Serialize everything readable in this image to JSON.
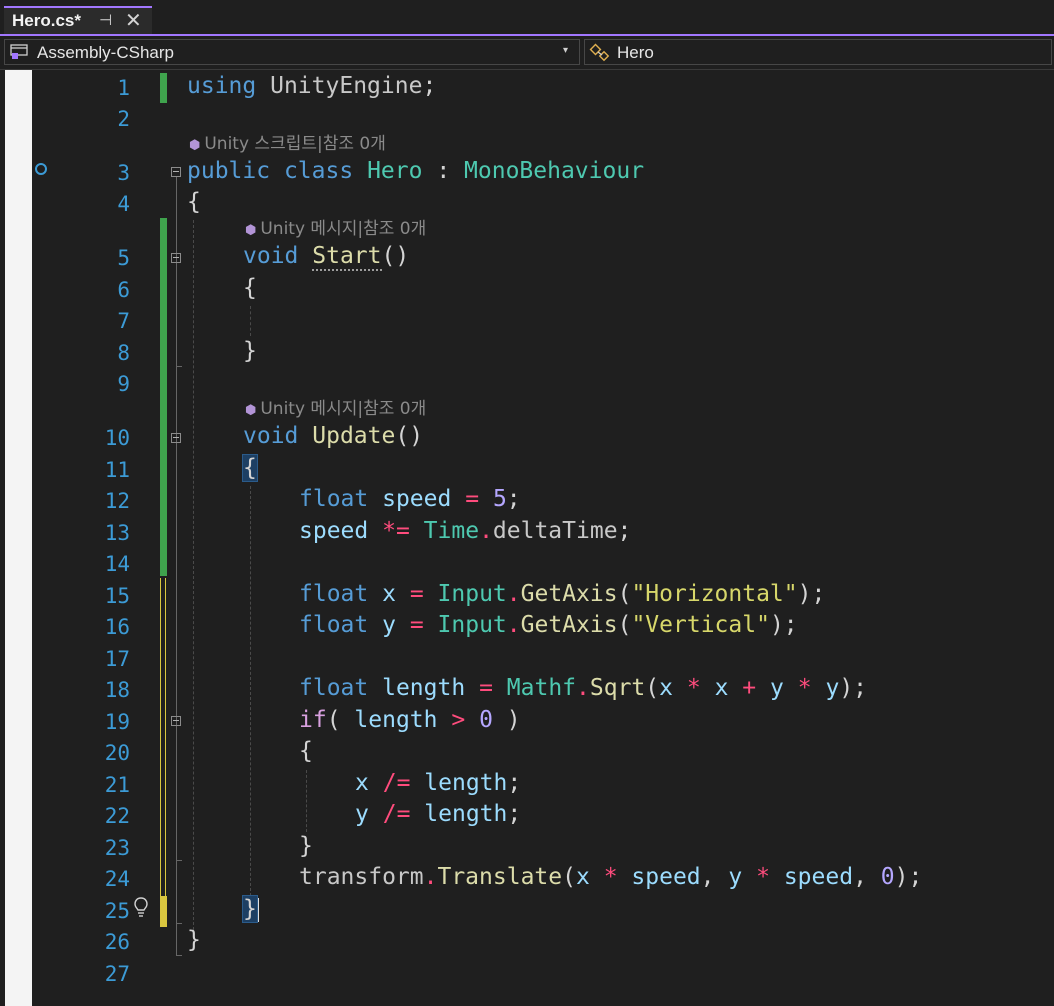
{
  "tab": {
    "title": "Hero.cs*",
    "pin": "⊣",
    "close": "✕"
  },
  "nav": {
    "project": "Assembly-CSharp",
    "dropdown": "▾",
    "class": "Hero"
  },
  "codelens": {
    "class_lens": "Unity 스크립트|참조 0개",
    "start_lens": "Unity 메시지|참조 0개",
    "update_lens": "Unity 메시지|참조 0개"
  },
  "code": {
    "l1": [
      "using",
      "UnityEngine",
      ";"
    ],
    "l3": [
      "public",
      "class",
      "Hero",
      ":",
      "MonoBehaviour"
    ],
    "brace_open": "{",
    "brace_close": "}",
    "void": "void",
    "start": "Start",
    "update": "Update",
    "parens": "()",
    "float": "float",
    "speed": "speed",
    "eq": "=",
    "five": "5",
    "semi": ";",
    "muleq": "*=",
    "time": "Time",
    "dot": ".",
    "deltaTime": "deltaTime",
    "x": "x",
    "y": "y",
    "input": "Input",
    "getaxis": "GetAxis",
    "horizontal": "\"Horizontal\"",
    "vertical": "\"Vertical\"",
    "length": "length",
    "mathf": "Mathf",
    "sqrt": "Sqrt",
    "mul": "*",
    "plus": "+",
    "if": "if",
    "gt": ">",
    "zero": "0",
    "diveq": "/=",
    "transform": "transform",
    "translate": "Translate",
    "comma": ","
  },
  "line_numbers": [
    "1",
    "2",
    "3",
    "4",
    "5",
    "6",
    "7",
    "8",
    "9",
    "10",
    "11",
    "12",
    "13",
    "14",
    "15",
    "16",
    "17",
    "18",
    "19",
    "20",
    "21",
    "22",
    "23",
    "24",
    "25",
    "26",
    "27"
  ],
  "colors": {
    "accent": "#a277ff",
    "line_number": "#3c9bd6",
    "saved_change": "#3fa34d",
    "unsaved_change": "#d9c63f"
  },
  "icons": {
    "project": "project-icon",
    "class": "class-icon",
    "lightbulb": "lightbulb-icon",
    "lens": "unity-cube-icon"
  }
}
